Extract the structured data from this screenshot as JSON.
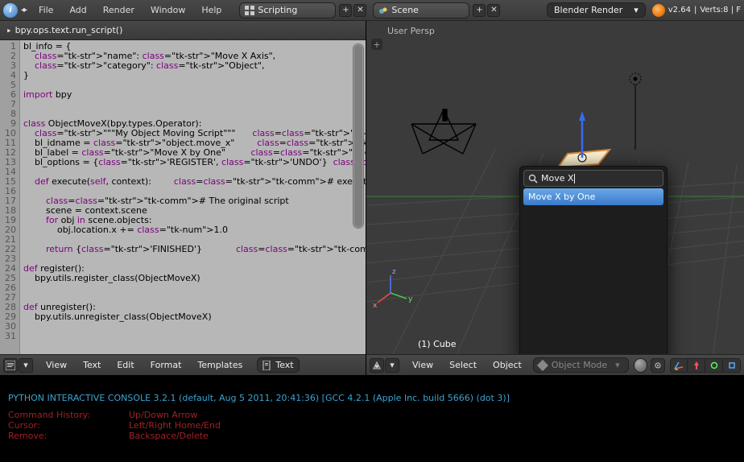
{
  "top": {
    "menus": [
      "File",
      "Add",
      "Render",
      "Window",
      "Help"
    ],
    "layout": "Scripting",
    "scene": "Scene",
    "engine": "Blender Render",
    "version": "v2.64",
    "stats": "Verts:8 | F"
  },
  "text_editor": {
    "run_line": "bpy.ops.text.run_script()",
    "menus": [
      "View",
      "Text",
      "Edit",
      "Format",
      "Templates"
    ],
    "datablock": "Text",
    "lines": [
      "bl_info = {",
      "    \"name\": \"Move X Axis\",",
      "    \"category\": \"Object\",",
      "}",
      "",
      "import bpy",
      "",
      "",
      "class ObjectMoveX(bpy.types.Operator):",
      "    \"\"\"My Object Moving Script\"\"\"      # blender will use",
      "    bl_idname = \"object.move_x\"        # unique identifier",
      "    bl_label = \"Move X by One\"         # display name in t",
      "    bl_options = {'REGISTER', 'UNDO'}  # enable undo for t",
      "",
      "    def execute(self, context):        # execute() is call",
      "",
      "        # The original script",
      "        scene = context.scene",
      "        for obj in scene.objects:",
      "            obj.location.x += 1.0",
      "",
      "        return {'FINISHED'}            # this lets blender",
      "",
      "def register():",
      "    bpy.utils.register_class(ObjectMoveX)",
      "",
      "",
      "def unregister():",
      "    bpy.utils.unregister_class(ObjectMoveX)",
      "",
      ""
    ]
  },
  "viewport": {
    "persp": "User Persp",
    "object": "(1) Cube",
    "menus": [
      "View",
      "Select",
      "Object"
    ],
    "mode": "Object Mode"
  },
  "search": {
    "query": "Move X",
    "result": "Move X by One"
  },
  "console": {
    "header": "PYTHON INTERACTIVE CONSOLE 3.2.1 (default, Aug  5 2011, 20:41:36)  [GCC 4.2.1 (Apple Inc. build 5666) (dot 3)]",
    "rows": [
      [
        "Command History:",
        "Up/Down Arrow"
      ],
      [
        "Cursor:",
        "Left/Right Home/End"
      ],
      [
        "Remove:",
        "Backspace/Delete"
      ]
    ]
  }
}
